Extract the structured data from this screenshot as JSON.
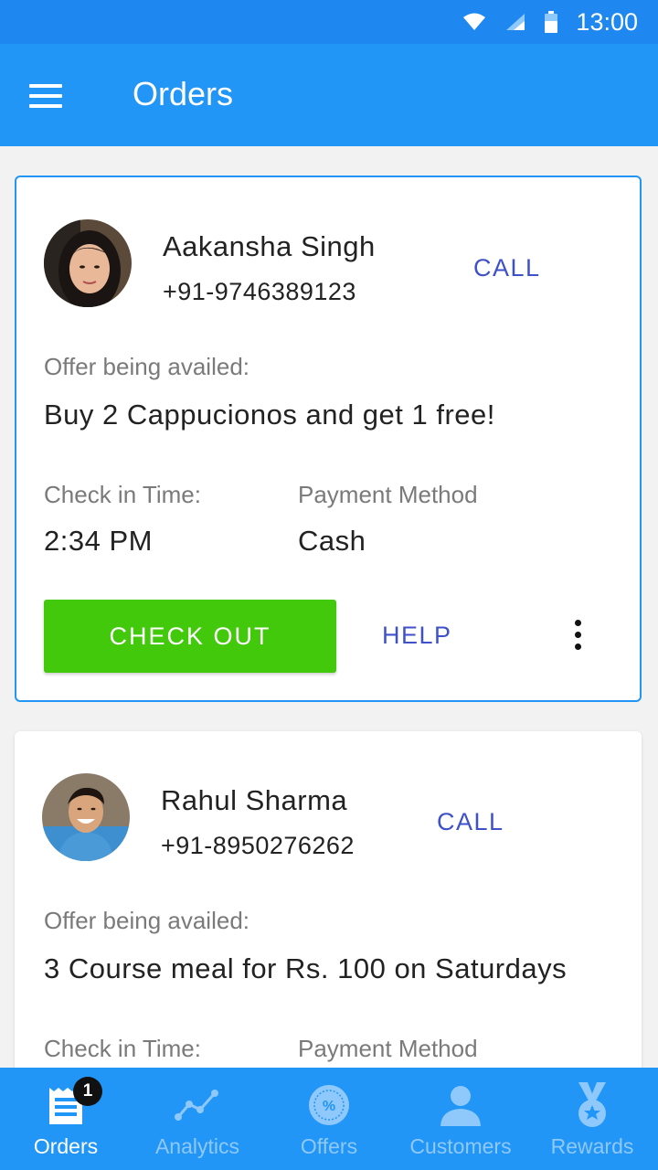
{
  "status_bar": {
    "time": "13:00"
  },
  "app_bar": {
    "title": "Orders"
  },
  "orders": [
    {
      "name": "Aakansha Singh",
      "phone": "+91-9746389123",
      "call_label": "CALL",
      "offer_label": "Offer being availed:",
      "offer": "Buy 2 Cappucionos and get 1 free!",
      "checkin_label": "Check in Time:",
      "checkin_time": "2:34 PM",
      "payment_label": "Payment Method",
      "payment_method": "Cash",
      "checkout_label": "CHECK OUT",
      "help_label": "HELP"
    },
    {
      "name": "Rahul Sharma",
      "phone": "+91-8950276262",
      "call_label": "CALL",
      "offer_label": "Offer being availed:",
      "offer": "3 Course meal for Rs. 100 on Saturdays",
      "checkin_label": "Check in Time:",
      "payment_label": "Payment Method"
    }
  ],
  "bottom_nav": {
    "items": [
      {
        "label": "Orders",
        "icon": "orders-icon",
        "badge": "1",
        "active": true
      },
      {
        "label": "Analytics",
        "icon": "analytics-icon"
      },
      {
        "label": "Offers",
        "icon": "offers-icon"
      },
      {
        "label": "Customers",
        "icon": "customers-icon"
      },
      {
        "label": "Rewards",
        "icon": "rewards-icon"
      }
    ]
  },
  "colors": {
    "primary": "#2196f6",
    "accent_text": "#3f51c8",
    "checkout_green": "#43c90c"
  }
}
